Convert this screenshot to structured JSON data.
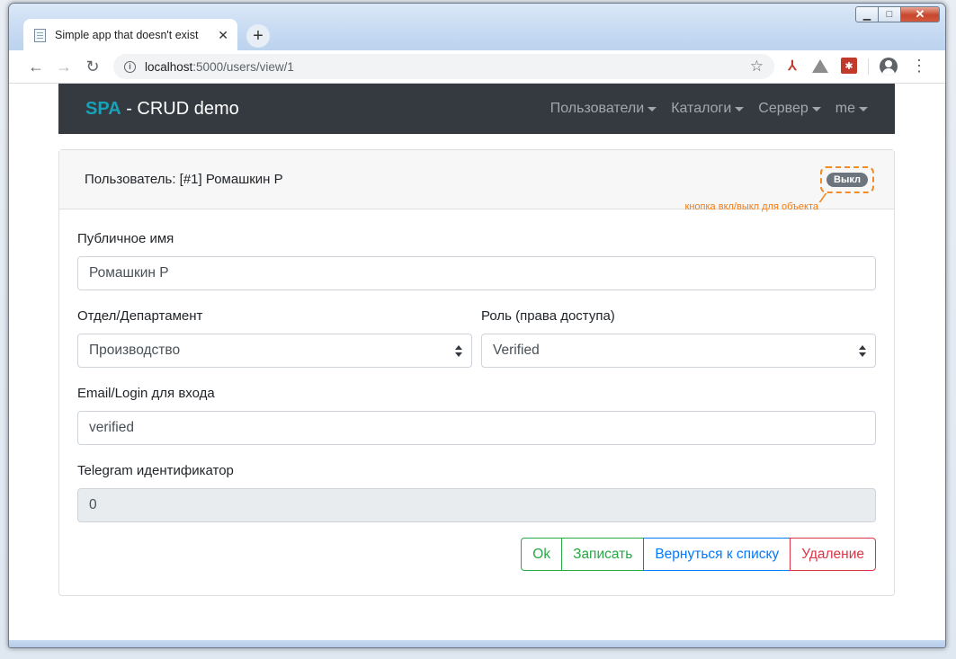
{
  "browser": {
    "tab_title": "Simple app that doesn't exist",
    "tab_close": "✕",
    "new_tab": "+",
    "url_host": "localhost",
    "url_path": ":5000/users/view/1",
    "back": "←",
    "forward": "→",
    "reload": "↻",
    "star": "☆",
    "menu": "⋮"
  },
  "navbar": {
    "brand_strong": "SPA",
    "brand_rest": " - CRUD demo",
    "items": [
      {
        "label": "Пользователи"
      },
      {
        "label": "Каталоги"
      },
      {
        "label": "Сервер"
      },
      {
        "label": "me"
      }
    ]
  },
  "card": {
    "title": "Пользователь: [#1] Ромашкин Р",
    "toggle_label": "Выкл",
    "callout": "кнопка вкл/выкл для объекта"
  },
  "form": {
    "public_name_label": "Публичное имя",
    "public_name_value": "Ромашкин Р",
    "department_label": "Отдел/Департамент",
    "department_value": "Производство",
    "role_label": "Роль (права доступа)",
    "role_value": "Verified",
    "email_label": "Email/Login для входа",
    "email_value": "verified",
    "telegram_label": "Telegram идентификатор",
    "telegram_value": "0"
  },
  "buttons": {
    "ok": "Ok",
    "save": "Записать",
    "back_to_list": "Вернуться к списку",
    "delete": "Удаление"
  },
  "colors": {
    "navbar_bg": "#343a40",
    "brand_accent": "#17a2b8",
    "success": "#28a745",
    "primary": "#007bff",
    "danger": "#dc3545",
    "callout": "#f28c28"
  }
}
